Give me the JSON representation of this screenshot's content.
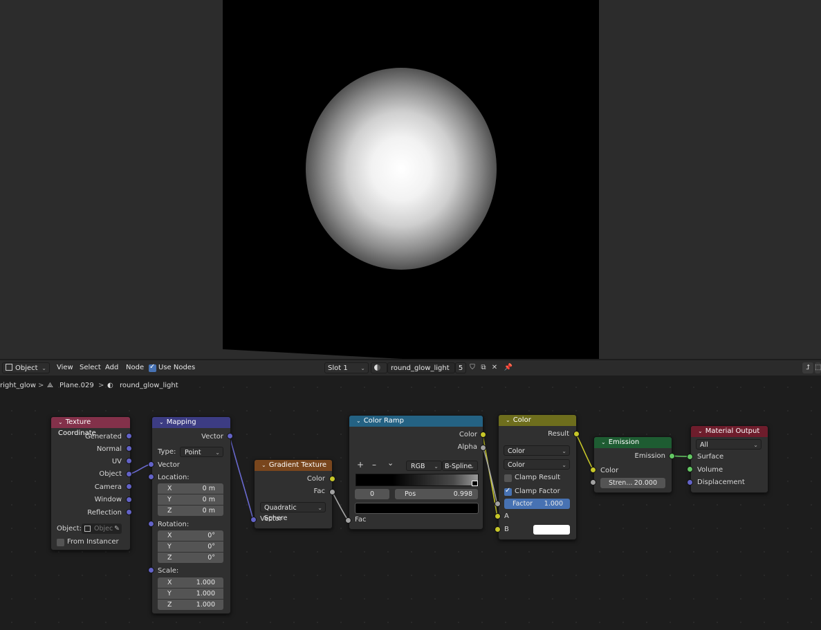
{
  "header": {
    "editor_mode": "Object",
    "menu": [
      "View",
      "Select",
      "Add",
      "Node"
    ],
    "use_nodes_label": "Use Nodes",
    "use_nodes_checked": true,
    "slot": "Slot 1",
    "material_name": "round_glow_light",
    "user_count": "5"
  },
  "breadcrumbs": [
    "right_glow",
    "Plane.029",
    "round_glow_light"
  ],
  "nodes": {
    "texcoord": {
      "title": "Texture Coordinate",
      "outputs": [
        "Generated",
        "Normal",
        "UV",
        "Object",
        "Camera",
        "Window",
        "Reflection"
      ],
      "object_label": "Object:",
      "object_placeholder": "Objec",
      "from_instancer": "From Instancer",
      "header_color": "#83314a"
    },
    "mapping": {
      "title": "Mapping",
      "output": "Vector",
      "type_label": "Type:",
      "type_value": "Point",
      "input_vector": "Vector",
      "location_label": "Location:",
      "location": [
        {
          "axis": "X",
          "value": "0 m"
        },
        {
          "axis": "Y",
          "value": "0 m"
        },
        {
          "axis": "Z",
          "value": "0 m"
        }
      ],
      "rotation_label": "Rotation:",
      "rotation": [
        {
          "axis": "X",
          "value": "0°"
        },
        {
          "axis": "Y",
          "value": "0°"
        },
        {
          "axis": "Z",
          "value": "0°"
        }
      ],
      "scale_label": "Scale:",
      "scale": [
        {
          "axis": "X",
          "value": "1.000"
        },
        {
          "axis": "Y",
          "value": "1.000"
        },
        {
          "axis": "Z",
          "value": "1.000"
        }
      ],
      "header_color": "#3c3c83"
    },
    "gradient": {
      "title": "Gradient Texture",
      "outputs": [
        "Color",
        "Fac"
      ],
      "gradient_type": "Quadratic Sphere",
      "input_vector": "Vector",
      "header_color": "#79461d"
    },
    "colorramp": {
      "title": "Color Ramp",
      "outputs": [
        "Color",
        "Alpha"
      ],
      "add": "+",
      "remove": "–",
      "more": "⌄",
      "mode": "RGB",
      "interp": "B-Spline",
      "stop_index": "0",
      "pos_label": "Pos",
      "pos_value": "0.998",
      "input_fac": "Fac",
      "header_color": "#246283"
    },
    "mix": {
      "title": "Color",
      "output": "Result",
      "blend_type": "Color",
      "data_type": "Color",
      "clamp_result": "Clamp Result",
      "clamp_result_checked": false,
      "clamp_factor": "Clamp Factor",
      "clamp_factor_checked": true,
      "factor_label": "Factor",
      "factor_value": "1.000",
      "input_a": "A",
      "input_b": "B",
      "b_color": "#ffffff",
      "header_color": "#6e6e1d"
    },
    "emission": {
      "title": "Emission",
      "output": "Emission",
      "input_color": "Color",
      "strength_label": "Stren...",
      "strength_value": "20.000",
      "header_color": "#1e5c32"
    },
    "output": {
      "title": "Material Output",
      "target": "All",
      "inputs": [
        "Surface",
        "Volume",
        "Displacement"
      ],
      "header_color": "#6e1d2c"
    }
  }
}
